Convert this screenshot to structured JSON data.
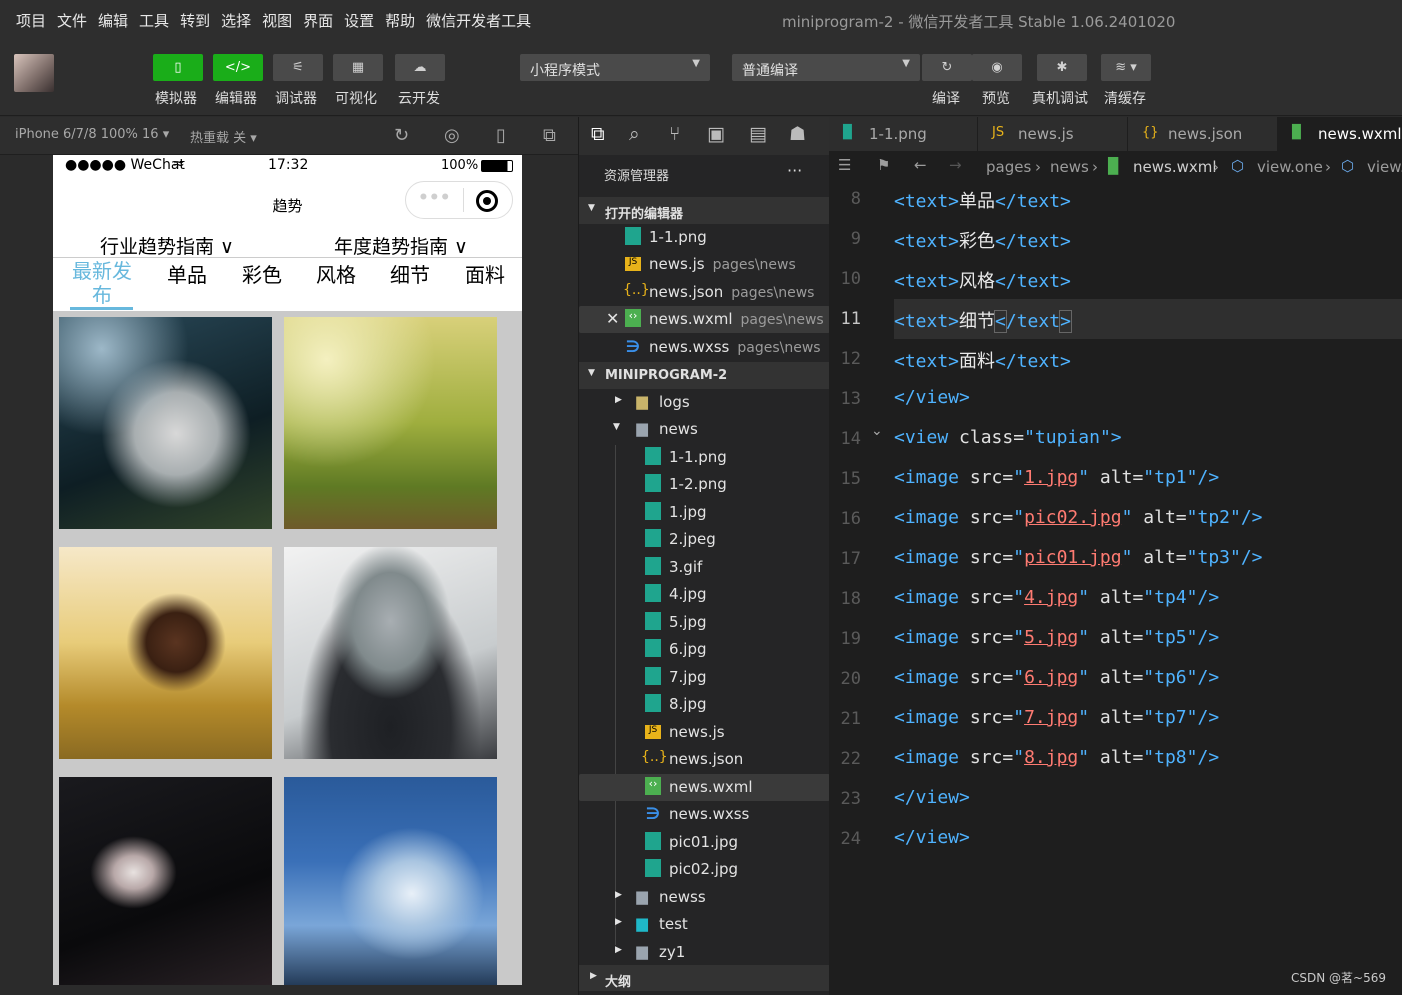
{
  "menu": [
    "项目",
    "文件",
    "编辑",
    "工具",
    "转到",
    "选择",
    "视图",
    "界面",
    "设置",
    "帮助",
    "微信开发者工具"
  ],
  "window_title": "miniprogram-2 - 微信开发者工具 Stable 1.06.2401020",
  "toolbar": {
    "simulator": "模拟器",
    "editor": "编辑器",
    "debugger": "调试器",
    "visual": "可视化",
    "cloud": "云开发",
    "mode": "小程序模式",
    "compile_mode": "普通编译",
    "compile": "编译",
    "preview": "预览",
    "remote_debug": "真机调试",
    "clear_cache": "清缓存"
  },
  "device": {
    "model": "iPhone 6/7/8 100% 16",
    "hot_reload": "热重载 关"
  },
  "phone": {
    "carrier": "●●●●● WeChat",
    "time": "17:32",
    "battery": "100%",
    "nav_title": "趋势",
    "guide1": "行业趋势指南 ∨",
    "guide2": "年度趋势指南 ∨",
    "categories": [
      "最新发布",
      "单品",
      "彩色",
      "风格",
      "细节",
      "面料"
    ]
  },
  "explorer": {
    "title": "资源管理器",
    "more": "···",
    "open_editors": "打开的编辑器",
    "project": "MINIPROGRAM-2",
    "outline": "大纲",
    "open_files": [
      {
        "name": "1-1.png",
        "path": ""
      },
      {
        "name": "news.js",
        "path": "pages\\news"
      },
      {
        "name": "news.json",
        "path": "pages\\news"
      },
      {
        "name": "news.wxml",
        "path": "pages\\news"
      },
      {
        "name": "news.wxss",
        "path": "pages\\news"
      }
    ],
    "tree": [
      "logs",
      "news",
      "1-1.png",
      "1-2.png",
      "1.jpg",
      "2.jpeg",
      "3.gif",
      "4.jpg",
      "5.jpg",
      "6.jpg",
      "7.jpg",
      "8.jpg",
      "news.js",
      "news.json",
      "news.wxml",
      "news.wxss",
      "pic01.jpg",
      "pic02.jpg",
      "newss",
      "test",
      "zy1"
    ]
  },
  "editor": {
    "tabs": [
      "1-1.png",
      "news.js",
      "news.json",
      "news.wxml"
    ],
    "crumbs": {
      "pages": "pages",
      "news": "news",
      "file": "news.wxml",
      "node1": "view.one",
      "node2": "view."
    },
    "line_numbers": [
      "8",
      "9",
      "10",
      "11",
      "12",
      "13",
      "14",
      "15",
      "16",
      "17",
      "18",
      "19",
      "20",
      "21",
      "22",
      "23",
      "24"
    ],
    "text_items": [
      "单品",
      "彩色",
      "风格",
      "细节",
      "面料"
    ],
    "tupian_class": "tupian",
    "images": [
      {
        "src": "1.jpg",
        "alt": "tp1"
      },
      {
        "src": "pic02.jpg",
        "alt": "tp2"
      },
      {
        "src": "pic01.jpg",
        "alt": "tp3"
      },
      {
        "src": "4.jpg",
        "alt": "tp4"
      },
      {
        "src": "5.jpg",
        "alt": "tp5"
      },
      {
        "src": "6.jpg",
        "alt": "tp6"
      },
      {
        "src": "7.jpg",
        "alt": "tp7"
      },
      {
        "src": "8.jpg",
        "alt": "tp8"
      }
    ]
  },
  "watermark": "CSDN @茗~569"
}
